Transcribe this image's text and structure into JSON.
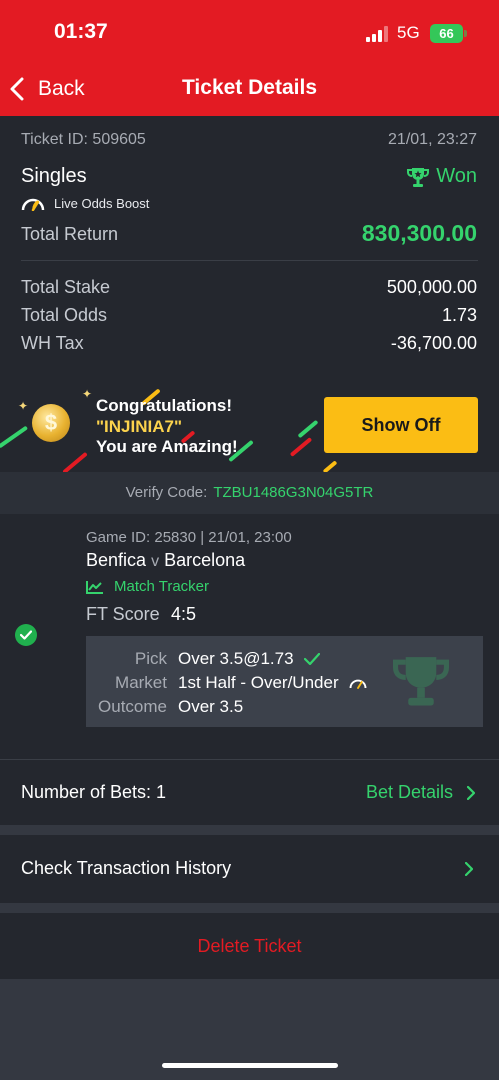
{
  "status_bar": {
    "time": "01:37",
    "network": "5G",
    "battery": "66"
  },
  "header": {
    "back_label": "Back",
    "title": "Ticket Details"
  },
  "ticket": {
    "id_text": "Ticket ID: 509605",
    "date": "21/01, 23:27",
    "bet_type": "Singles",
    "status": "Won",
    "boost_label": "Live Odds Boost",
    "total_return_label": "Total Return",
    "total_return": "830,300.00",
    "rows": [
      {
        "label": "Total Stake",
        "value": "500,000.00"
      },
      {
        "label": "Total Odds",
        "value": "1.73"
      },
      {
        "label": "WH Tax",
        "value": "-36,700.00"
      }
    ]
  },
  "banner": {
    "line1": "Congratulations!",
    "username": "\"INJINIA7\"",
    "line3": "You are Amazing!",
    "button_label": "Show Off",
    "coin_symbol": "$"
  },
  "verify": {
    "label": "Verify Code:",
    "code": "TZBU1486G3N04G5TR"
  },
  "game": {
    "id_text": "Game ID: 25830 | 21/01, 23:00",
    "home": "Benfica",
    "vs": "v",
    "away": "Barcelona",
    "tracker_label": "Match Tracker",
    "score_label": "FT Score",
    "score": "4:5",
    "pick_label": "Pick",
    "pick": "Over 3.5@1.73",
    "market_label": "Market",
    "market": "1st Half - Over/Under",
    "outcome_label": "Outcome",
    "outcome": "Over 3.5"
  },
  "bets": {
    "label": "Number of Bets: 1",
    "details_label": "Bet Details"
  },
  "history": {
    "label": "Check Transaction History"
  },
  "delete": {
    "label": "Delete Ticket"
  },
  "colors": {
    "brand_red": "#e31b23",
    "win_green": "#35d36d",
    "accent_yellow": "#fbbd14",
    "panel": "#24272e"
  }
}
